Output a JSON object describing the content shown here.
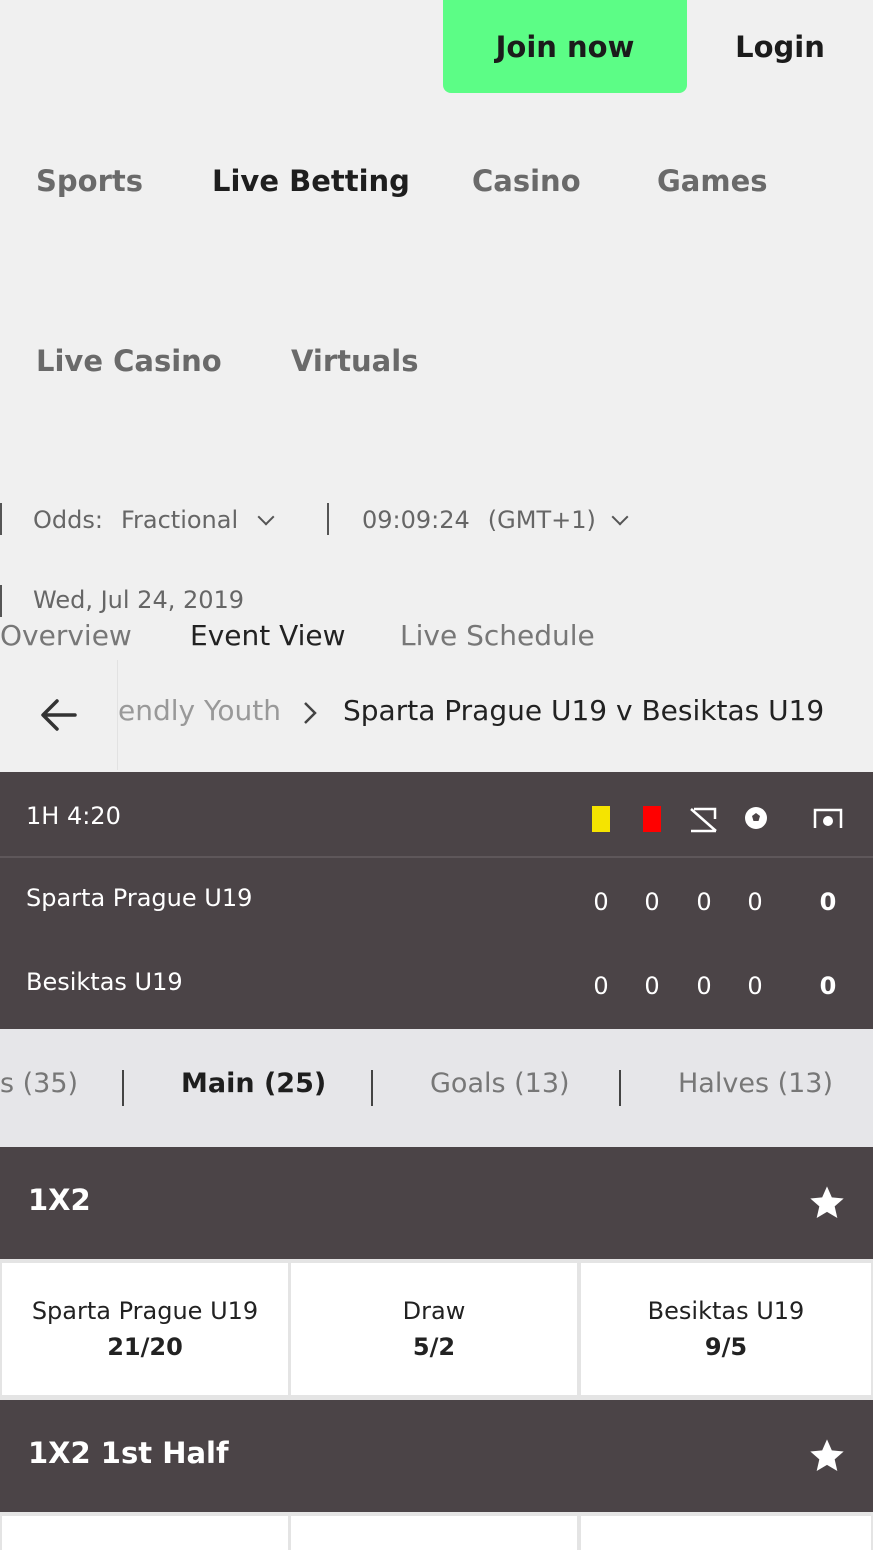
{
  "header": {
    "join_label": "Join now",
    "login_label": "Login"
  },
  "nav": {
    "items": [
      {
        "label": "Sports"
      },
      {
        "label": "Live Betting"
      },
      {
        "label": "Casino"
      },
      {
        "label": "Games"
      },
      {
        "label": "Live Casino"
      },
      {
        "label": "Virtuals"
      }
    ]
  },
  "settings": {
    "odds_label": "Odds:",
    "odds_value": "Fractional",
    "time": "09:09:24",
    "timezone": "(GMT+1)",
    "date": "Wed, Jul 24, 2019"
  },
  "subtabs": [
    {
      "label": "Overview"
    },
    {
      "label": "Event View"
    },
    {
      "label": "Live Schedule"
    }
  ],
  "breadcrumb": {
    "parent": "endly Youth",
    "current": "Sparta Prague U19 v Besiktas U19"
  },
  "scoreboard": {
    "clock": "1H 4:20",
    "teams": [
      {
        "name": "Sparta Prague U19",
        "stats": [
          "0",
          "0",
          "0",
          "0"
        ],
        "total": "0"
      },
      {
        "name": "Besiktas U19",
        "stats": [
          "0",
          "0",
          "0",
          "0"
        ],
        "total": "0"
      }
    ],
    "colors": {
      "yellow_card": "#f5e400",
      "red_card": "#ff0000"
    }
  },
  "market_tabs": [
    {
      "label": "s (35)"
    },
    {
      "label": "Main (25)"
    },
    {
      "label": "Goals (13)"
    },
    {
      "label": "Halves (13)"
    }
  ],
  "markets": [
    {
      "title": "1X2",
      "selections": [
        {
          "name": "Sparta Prague U19",
          "price": "21/20"
        },
        {
          "name": "Draw",
          "price": "5/2"
        },
        {
          "name": "Besiktas U19",
          "price": "9/5"
        }
      ]
    },
    {
      "title": "1X2 1st Half"
    }
  ],
  "colors": {
    "accent": "#5cfd86",
    "dark_panel": "#4b4447"
  }
}
